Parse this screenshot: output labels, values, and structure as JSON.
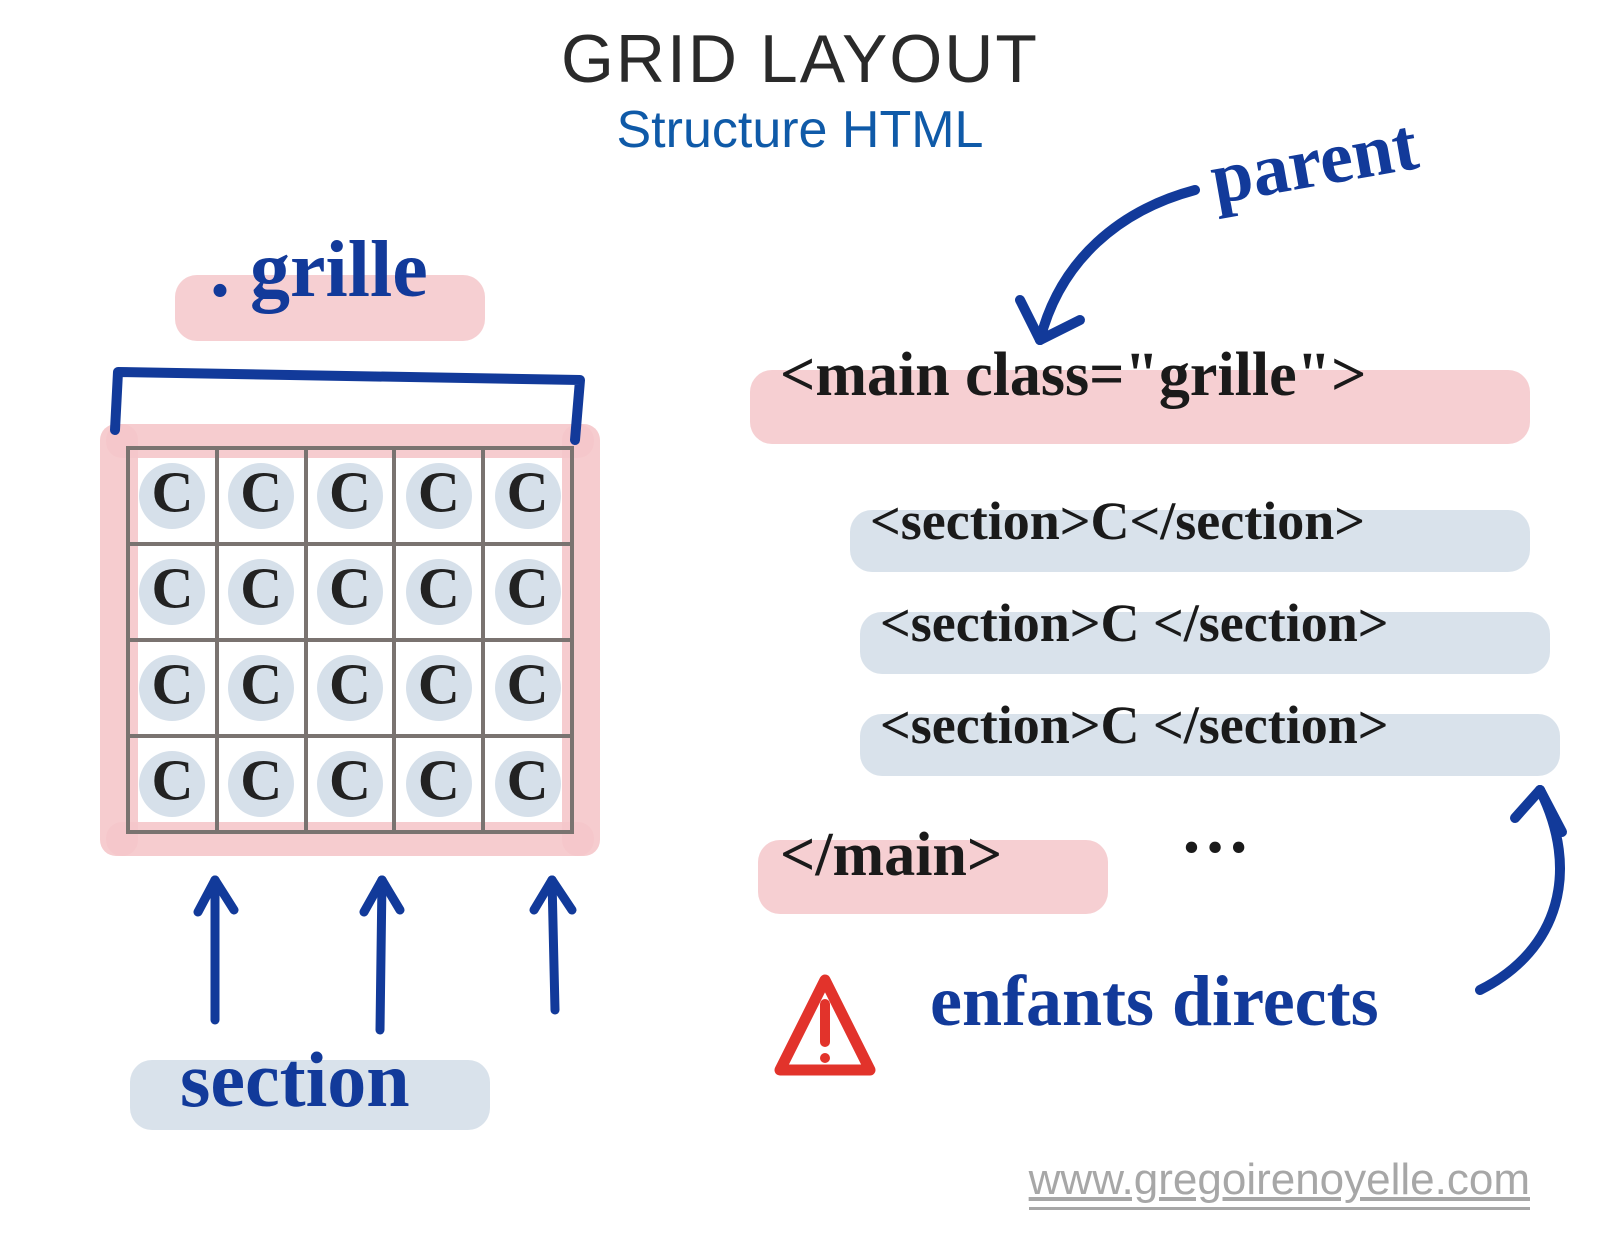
{
  "title": "GRID LAYOUT",
  "subtitle": "Structure HTML",
  "left": {
    "container_class_label": ". grille",
    "item_label": "section",
    "grid": {
      "rows": 4,
      "cols": 5,
      "cell_content": "C"
    }
  },
  "right": {
    "parent_annotation": "parent",
    "code_open": "<main class=\"grille\">",
    "code_children": [
      "<section>C</section>",
      "<section>C </section>",
      "<section>C </section>"
    ],
    "ellipsis": "…",
    "code_close": "</main>",
    "children_annotation": "enfants directs"
  },
  "footer_url": "www.gregoirenoyelle.com",
  "colors": {
    "ink_blue": "#123a9a",
    "ink_dark": "#1a1a1a",
    "hl_pink": "#f5c7ca",
    "hl_blue": "#d2dde8",
    "warn_red": "#e2332b",
    "title_blue": "#0f5aa8"
  }
}
